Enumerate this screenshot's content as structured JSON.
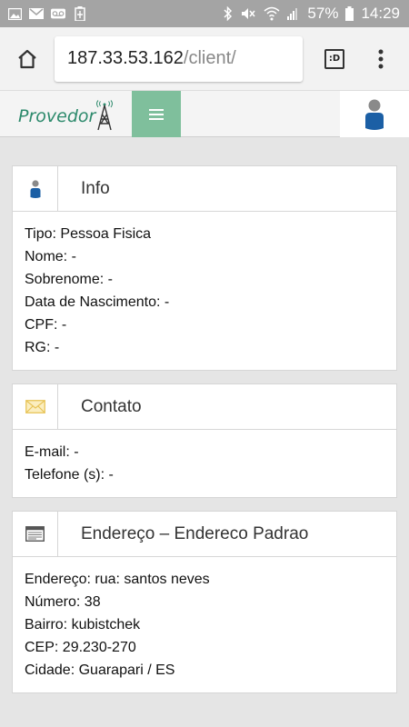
{
  "status_bar": {
    "battery": "57%",
    "time": "14:29"
  },
  "browser": {
    "url_host": "187.33.53.162",
    "url_path": "/client/",
    "tabs_label": ":D"
  },
  "app": {
    "logo_text": "Provedor",
    "logo_letter": "A"
  },
  "info_panel": {
    "title": "Info",
    "rows": [
      "Tipo: Pessoa Fisica",
      "Nome: -",
      "Sobrenome: -",
      "Data de Nascimento: -",
      "CPF: -",
      "RG: -"
    ]
  },
  "contact_panel": {
    "title": "Contato",
    "rows": [
      "E-mail: -",
      "Telefone (s): -"
    ]
  },
  "address_panel": {
    "title": "Endereço – Endereco Padrao",
    "rows": [
      "Endereço: rua: santos neves",
      "Número: 38",
      "Bairro: kubistchek",
      "CEP: 29.230-270",
      "Cidade: Guarapari / ES"
    ]
  },
  "colors": {
    "status_bar": "#a4a4a4",
    "brand_green": "#2d8a6c",
    "menu_green": "#7fbf9c",
    "user_blue": "#1b5fa5",
    "envelope_yellow": "#e8c458"
  },
  "icons": [
    "image-icon",
    "mail-icon",
    "voicemail-icon",
    "battery-saver-icon",
    "bluetooth-icon",
    "mute-icon",
    "wifi-icon",
    "signal-icon",
    "battery-icon",
    "home-icon",
    "tabs-icon",
    "more-vert-icon",
    "hamburger-icon",
    "user-icon",
    "envelope-icon",
    "address-card-icon"
  ]
}
